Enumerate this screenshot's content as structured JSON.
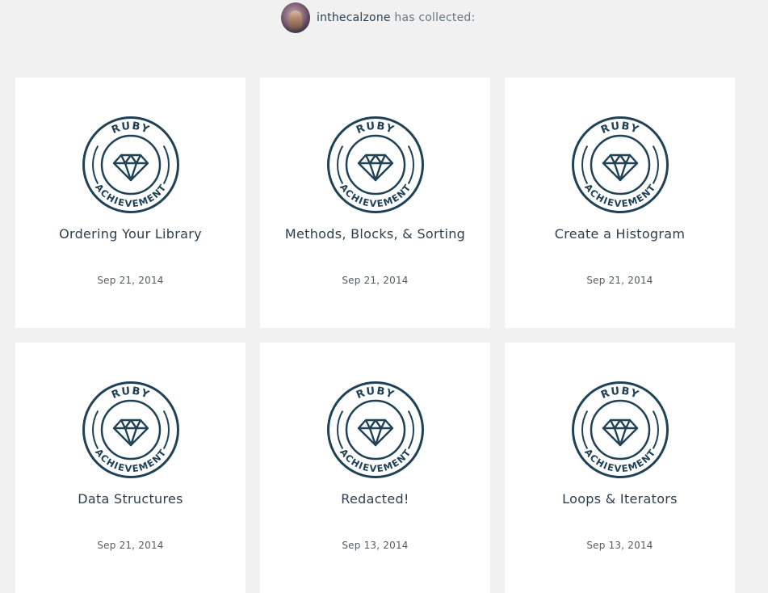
{
  "header": {
    "username": "inthecalzone",
    "collected_text": " has collected:"
  },
  "badge": {
    "top_text": "RUBY",
    "bottom_text": "ACHIEVEMENT",
    "icon": "gem-icon",
    "color": "#1f4256"
  },
  "achievements": [
    {
      "title": "Ordering Your Library",
      "date": "Sep 21, 2014"
    },
    {
      "title": "Methods, Blocks, & Sorting",
      "date": "Sep 21, 2014"
    },
    {
      "title": "Create a Histogram",
      "date": "Sep 21, 2014"
    },
    {
      "title": "Data Structures",
      "date": "Sep 21, 2014"
    },
    {
      "title": "Redacted!",
      "date": "Sep 13, 2014"
    },
    {
      "title": "Loops & Iterators",
      "date": "Sep 13, 2014"
    }
  ]
}
